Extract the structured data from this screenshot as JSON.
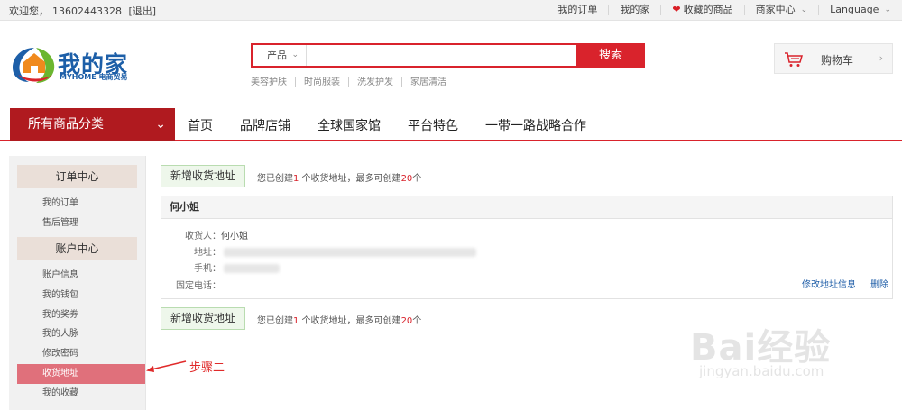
{
  "topbar": {
    "welcome": "欢迎您，",
    "phone": "13602443328",
    "logout": "[退出]",
    "links": {
      "orders": "我的订单",
      "myhome": "我的家",
      "favorites": "收藏的商品",
      "merchant": "商家中心",
      "language": "Language"
    }
  },
  "header": {
    "logo_text": "我的家",
    "logo_sub": "MYHOME 电商贸易",
    "search": {
      "category": "产品",
      "placeholder": "",
      "button": "搜索",
      "hotwords": [
        "美容护肤",
        "时尚服装",
        "洗发护发",
        "家居清洁"
      ]
    },
    "cart_label": "购物车"
  },
  "nav": {
    "all_categories": "所有商品分类",
    "items": [
      "首页",
      "品牌店铺",
      "全球国家馆",
      "平台特色",
      "一带一路战略合作"
    ]
  },
  "sidebar": {
    "order_center": "订单中心",
    "order_items": [
      "我的订单",
      "售后管理"
    ],
    "account_center": "账户中心",
    "account_items": [
      "账户信息",
      "我的钱包",
      "我的奖券",
      "我的人脉",
      "修改密码",
      "收货地址",
      "我的收藏"
    ]
  },
  "address": {
    "add_button": "新增收货地址",
    "info_prefix": "您已创建",
    "created": "1",
    "info_mid": " 个收货地址，最多可创建",
    "max": "20",
    "info_suffix": "个",
    "card": {
      "name": "何小姐",
      "consignee_label": "收货人：",
      "consignee_value": "何小姐",
      "address_label": "地址：",
      "mobile_label": "手机：",
      "phone_label": "固定电话：",
      "edit": "修改地址信息",
      "delete": "删除"
    }
  },
  "annotation": {
    "step": "步骤二"
  },
  "watermark": {
    "big": "Bai经验",
    "small": "jingyan.baidu.com"
  },
  "colors": {
    "brand_red": "#d9232c",
    "nav_dark_red": "#b01a1f",
    "active_pink": "#e0707b",
    "link_blue": "#1f5ea8"
  }
}
